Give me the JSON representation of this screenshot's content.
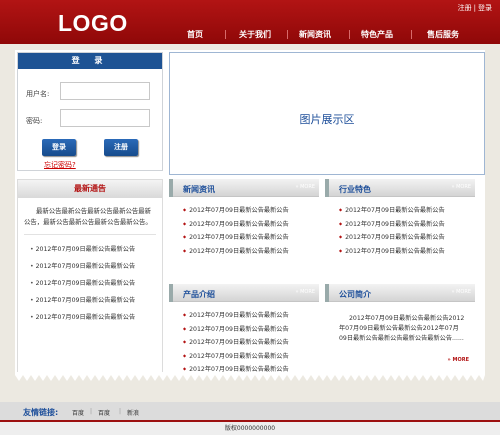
{
  "header": {
    "logo": "LOGO",
    "register": "注册",
    "login": "登录",
    "nav": [
      "首页",
      "关于我们",
      "新闻资讯",
      "特色产品",
      "售后服务"
    ]
  },
  "login": {
    "title": "登 录",
    "username_label": "用户名:",
    "password_label": "密码:",
    "login_button": "登录",
    "register_button": "注册",
    "forgot": "忘记密码?"
  },
  "gallery": {
    "label": "图片展示区"
  },
  "notice": {
    "title": "最新通告",
    "body": "最新公告最新公告最新公告最新公告最新公告，最新公告最新公告最新公告最新公告。",
    "items": [
      "2012年07月09日最新公告最新公告",
      "2012年07月09日最新公告最新公告",
      "2012年07月09日最新公告最新公告",
      "2012年07月09日最新公告最新公告",
      "2012年07月09日最新公告最新公告"
    ]
  },
  "news": {
    "title": "新闻资讯",
    "more": "MORE",
    "items": [
      "2012年07月09日最新公告最新公告",
      "2012年07月09日最新公告最新公告",
      "2012年07月09日最新公告最新公告",
      "2012年07月09日最新公告最新公告"
    ]
  },
  "industry": {
    "title": "行业特色",
    "more": "MORE",
    "items": [
      "2012年07月09日最新公告最新公告",
      "2012年07月09日最新公告最新公告",
      "2012年07月09日最新公告最新公告",
      "2012年07月09日最新公告最新公告"
    ]
  },
  "products": {
    "title": "产品介绍",
    "more": "MORE",
    "items": [
      "2012年07月09日最新公告最新公告",
      "2012年07月09日最新公告最新公告",
      "2012年07月09日最新公告最新公告",
      "2012年07月09日最新公告最新公告",
      "2012年07月09日最新公告最新公告"
    ]
  },
  "company": {
    "title": "公司简介",
    "more": "MORE",
    "text": "2012年07月09日最新公告最新公告2012年07月09日最新公告最新公告2012年07月09日最新公告最新公告最新公告最新公告......",
    "more_red": "MORE"
  },
  "footer": {
    "friends_label": "友情链接:",
    "links": [
      "百度",
      "百度",
      "新浪"
    ],
    "copyright": "版权0000000000"
  },
  "colors": {
    "brand_red": "#a10d0d",
    "brand_blue": "#1e5394"
  }
}
